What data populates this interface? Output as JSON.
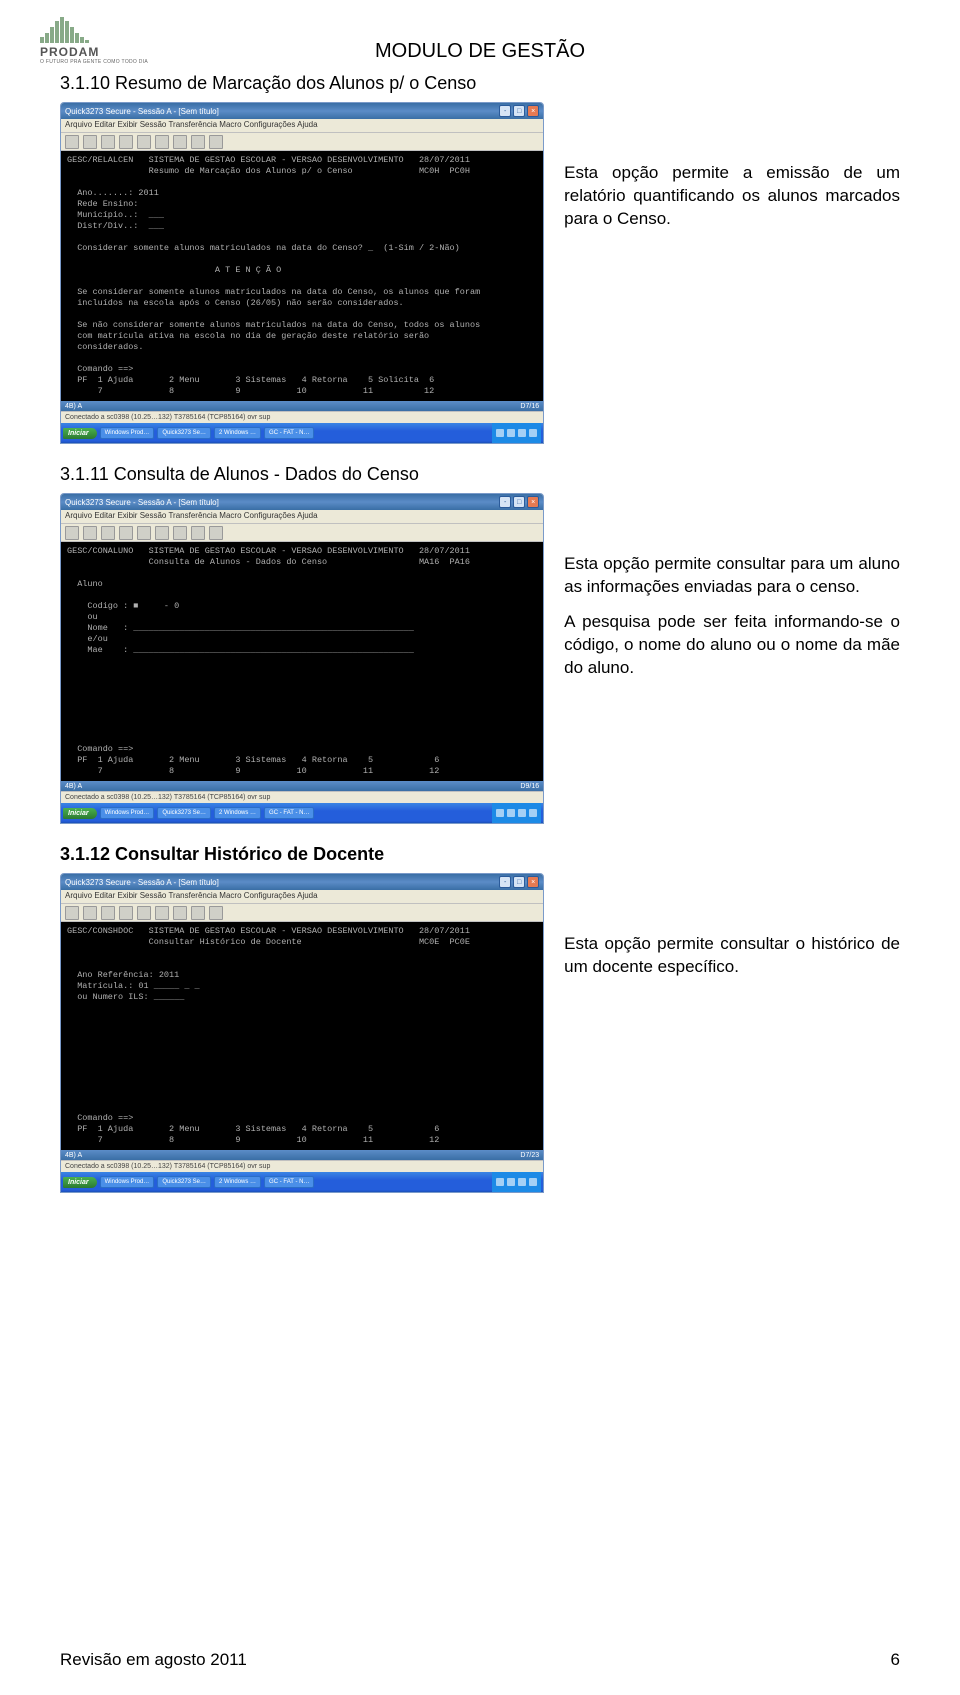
{
  "logo": {
    "brand": "PRODAM",
    "tagline": "O FUTURO PRA GENTE COMO TODO DIA"
  },
  "doc_header": "MODULO DE GESTÃO",
  "sections": [
    {
      "title": "3.1.10 Resumo de Marcação dos Alunos p/ o Censo",
      "title_bold": false,
      "side_text": "Esta opção permite a emissão de um relatório quantificando os alunos marcados para o Censo.",
      "terminal": {
        "title": "Quick3273 Secure - Sessão A - [Sem título]",
        "menu": "Arquivo  Editar  Exibir  Sessão  Transferência  Macro  Configurações  Ajuda",
        "status_left": "4B)   A",
        "status_right": "D7/16",
        "conn": "Conectado a sc0398 (10.25…132)                          T3785164 (TCP85164)                    ovr      sup",
        "body": "GESC/RELALCEN   SISTEMA DE GESTAO ESCOLAR - VERSAO DESENVOLVIMENTO   28/07/2011\n                Resumo de Marcação dos Alunos p/ o Censo             MC0H  PC0H\n\n  Ano.......: 2011\n  Rede Ensino:\n  Município..:  ___\n  Distr/Div..:  ___\n\n  Considerar somente alunos matriculados na data do Censo? _  (1-Sim / 2-Não)\n\n                             A T E N Ç Ã O\n\n  Se considerar somente alunos matriculados na data do Censo, os alunos que foram\n  incluídos na escola após o Censo (26/05) não serão considerados.\n\n  Se não considerar somente alunos matriculados na data do Censo, todos os alunos\n  com matrícula ativa na escola no dia de geração deste relatório serão\n  considerados.\n\n  Comando ==>\n  PF  1 Ajuda       2 Menu       3 Sistemas   4 Retorna    5 Solicita  6\n      7             8            9           10           11          12"
      }
    },
    {
      "title": "3.1.11 Consulta de Alunos - Dados do Censo",
      "title_bold": false,
      "side_text": "Esta opção permite consultar para um aluno as informações enviadas para o censo.\nA pesquisa pode ser feita informando-se o código, o nome do aluno ou o nome da mãe do aluno.",
      "terminal": {
        "title": "Quick3273 Secure - Sessão A - [Sem título]",
        "menu": "Arquivo  Editar  Exibir  Sessão  Transferência  Macro  Configurações  Ajuda",
        "status_left": "4B)   A",
        "status_right": "D9/16",
        "conn": "Conectado a sc0398 (10.25…132)                          T3785164 (TCP85164)                    ovr      sup",
        "body": "GESC/CONALUNO   SISTEMA DE GESTAO ESCOLAR - VERSAO DESENVOLVIMENTO   28/07/2011\n                Consulta de Alunos - Dados do Censo                  MA16  PA16\n\n  Aluno\n\n    Codigo : ■     - 0\n    ou\n    Nome   : _______________________________________________________\n    e/ou\n    Mae    : _______________________________________________________\n\n\n\n\n\n\n\n\n  Comando ==>\n  PF  1 Ajuda       2 Menu       3 Sistemas   4 Retorna    5            6\n      7             8            9           10           11           12"
      }
    },
    {
      "title": "3.1.12 Consultar Histórico de Docente",
      "title_bold": true,
      "side_text": "Esta opção permite consultar o histórico de um docente específico.",
      "terminal": {
        "title": "Quick3273 Secure - Sessão A - [Sem título]",
        "menu": "Arquivo  Editar  Exibir  Sessão  Transferência  Macro  Configurações  Ajuda",
        "status_left": "4B)   A",
        "status_right": "D7/23",
        "conn": "Conectado a sc0398 (10.25…132)                          T3785164 (TCP85164)                    ovr      sup",
        "body": "GESC/CONSHDOC   SISTEMA DE GESTAO ESCOLAR - VERSAO DESENVOLVIMENTO   28/07/2011\n                Consultar Histórico de Docente                       MC0E  PC0E\n\n\n  Ano Referência: 2011\n  Matrícula.: 01 _____ _ _\n  ou Numero ILS: ______\n\n\n\n\n\n\n\n\n\n\n  Comando ==>\n  PF  1 Ajuda       2 Menu       3 Sistemas   4 Retorna    5            6\n      7             8            9           10           11           12"
      }
    }
  ],
  "taskbar": {
    "start": "Iniciar",
    "items": [
      "Windows Prod…",
      "Quick3273 Se…",
      "2 Windows …",
      "GC - FAT - N…"
    ]
  },
  "footer": {
    "left": "Revisão em agosto 2011",
    "right": "6"
  }
}
